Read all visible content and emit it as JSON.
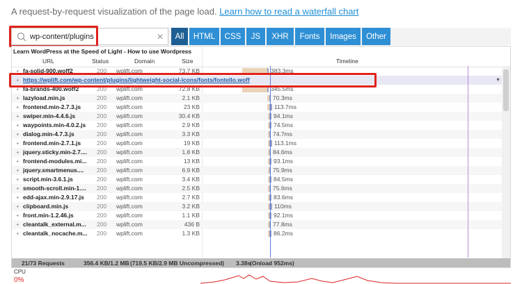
{
  "intro": {
    "text": "A request-by-request visualization of the page load.",
    "link": "Learn how to read a waterfall chart"
  },
  "filter": {
    "search_value": "wp-content/plugins",
    "tabs": [
      "All",
      "HTML",
      "CSS",
      "JS",
      "XHR",
      "Fonts",
      "Images",
      "Other"
    ],
    "active_tab": "All"
  },
  "waterfall": {
    "page_title": "Learn WordPress at the Speed of Light - How to use Wordpress",
    "headers": {
      "url": "URL",
      "status": "Status",
      "domain": "Domain",
      "size": "Size",
      "timeline": "Timeline"
    },
    "selected_url": "https://wplift.com/wp-content/plugins/lightweight-social-icons/fonts/fontello.woff",
    "rows": [
      {
        "url": "fa-solid-900.woff2",
        "status": "200",
        "domain": "wplift.com",
        "size": "73.7 KB",
        "time": "383.3ms"
      },
      {
        "url": "fa-brands-400.woff2",
        "status": "200",
        "domain": "wplift.com",
        "size": "72.8 KB",
        "time": "345.5ms"
      },
      {
        "url": "lazyload.min.js",
        "status": "200",
        "domain": "wplift.com",
        "size": "2.1 KB",
        "time": "70.3ms"
      },
      {
        "url": "frontend.min-2.7.3.js",
        "status": "200",
        "domain": "wplift.com",
        "size": "23 KB",
        "time": "113.7ms"
      },
      {
        "url": "swiper.min-4.4.6.js",
        "status": "200",
        "domain": "wplift.com",
        "size": "30.4 KB",
        "time": "94.1ms"
      },
      {
        "url": "waypoints.min-4.0.2.js",
        "status": "200",
        "domain": "wplift.com",
        "size": "2.9 KB",
        "time": "74.5ms"
      },
      {
        "url": "dialog.min-4.7.3.js",
        "status": "200",
        "domain": "wplift.com",
        "size": "3.3 KB",
        "time": "74.7ms"
      },
      {
        "url": "frontend.min-2.7.1.js",
        "status": "200",
        "domain": "wplift.com",
        "size": "19 KB",
        "time": "113.1ms"
      },
      {
        "url": "jquery.sticky.min-2.7....",
        "status": "200",
        "domain": "wplift.com",
        "size": "1.8 KB",
        "time": "84.6ms"
      },
      {
        "url": "frontend-modules.mi...",
        "status": "200",
        "domain": "wplift.com",
        "size": "13 KB",
        "time": "93.1ms"
      },
      {
        "url": "jquery.smartmenus....",
        "status": "200",
        "domain": "wplift.com",
        "size": "6.9 KB",
        "time": "75.9ms"
      },
      {
        "url": "script.min-3.6.1.js",
        "status": "200",
        "domain": "wplift.com",
        "size": "3.4 KB",
        "time": "84.5ms"
      },
      {
        "url": "smooth-scroll.min-1....",
        "status": "200",
        "domain": "wplift.com",
        "size": "2.5 KB",
        "time": "75.6ms"
      },
      {
        "url": "edd-ajax.min-2.9.17.js",
        "status": "200",
        "domain": "wplift.com",
        "size": "2.7 KB",
        "time": "83.6ms"
      },
      {
        "url": "clipboard.min.js",
        "status": "200",
        "domain": "wplift.com",
        "size": "3.2 KB",
        "time": "110ms"
      },
      {
        "url": "front.min-1.2.46.js",
        "status": "200",
        "domain": "wplift.com",
        "size": "1.1 KB",
        "time": "92.1ms"
      },
      {
        "url": "cleantalk_external.m...",
        "status": "200",
        "domain": "wplift.com",
        "size": "436 B",
        "time": "77.8ms"
      },
      {
        "url": "cleantalk_nocache.m...",
        "status": "200",
        "domain": "wplift.com",
        "size": "1.3 KB",
        "time": "86.2ms"
      }
    ],
    "footer": {
      "requests": "21/73 Requests",
      "size": "356.4 KB/1.2 MB",
      "uncompressed": "(719.5 KB/2.9 MB Uncompressed)",
      "time": "3.38s",
      "onload": "(Onload 952ms)"
    }
  },
  "cpu": {
    "label": "CPU",
    "value": "0%"
  },
  "colors": {
    "accent": "#2f8fd4",
    "active_tab": "#1d5f94",
    "highlight": "#e0221b",
    "wait_bar": "#e9d3b9",
    "receive_bar": "#9ea0c6"
  }
}
